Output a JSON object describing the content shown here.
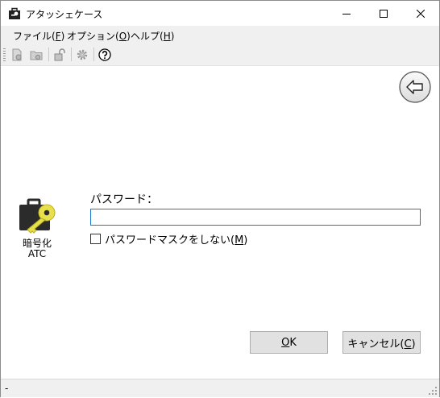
{
  "window": {
    "title": "アタッシェケース"
  },
  "menu": [
    {
      "label": "ファイル(",
      "key": "F",
      "suffix": ")"
    },
    {
      "label": "オプション(",
      "key": "O",
      "suffix": ")"
    },
    {
      "label": "ヘルプ(",
      "key": "H",
      "suffix": ")"
    }
  ],
  "toolbar": {
    "icons": [
      "encrypt-file-icon",
      "encrypt-folder-icon",
      "decrypt-icon",
      "settings-gear-icon",
      "help-icon"
    ]
  },
  "main": {
    "back_icon": "arrow-left-icon",
    "file_icon_label_line1": "暗号化",
    "file_icon_label_line2": "ATC",
    "password_label": "パスワード：",
    "password_value": "",
    "mask_checkbox_label": "パスワードマスクをしない(",
    "mask_checkbox_key": "M",
    "mask_checkbox_suffix": ")",
    "mask_checked": false
  },
  "buttons": {
    "ok_key": "O",
    "ok_rest": "K",
    "cancel_label": "キャンセル(",
    "cancel_key": "C",
    "cancel_suffix": ")"
  },
  "status": {
    "text": "-"
  },
  "colors": {
    "accent": "#1979ca",
    "key_yellow": "#e8e04a",
    "bag_dark": "#2b2b2b"
  }
}
